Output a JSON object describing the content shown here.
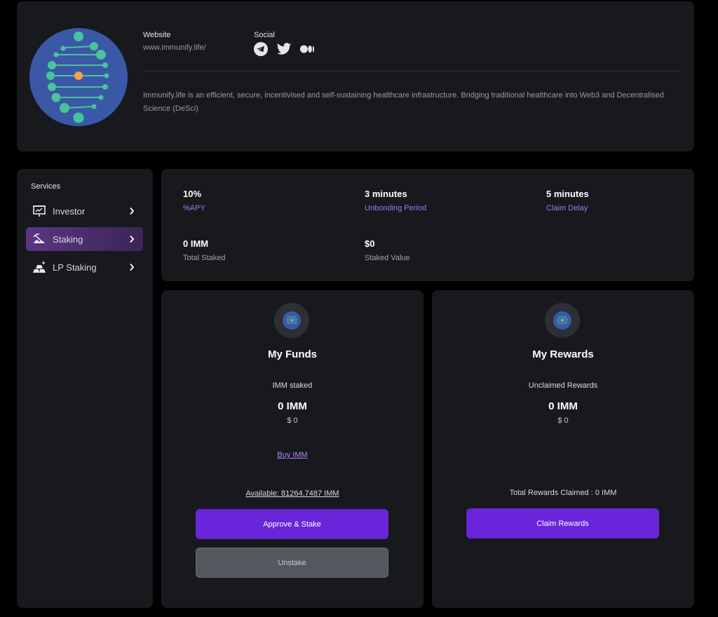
{
  "project": {
    "website_label": "Website",
    "website_url": "www.immunify.life/",
    "social_label": "Social",
    "social_icons": [
      "telegram-icon",
      "twitter-icon",
      "medium-icon"
    ],
    "description": "Immunify.life is an efficient, secure, incentivised and self-sustaining healthcare infrastructure. Bridging traditional healthcare into Web3 and Decentralised Science (DeSci)"
  },
  "sidebar": {
    "title": "Services",
    "items": [
      {
        "label": "Investor",
        "icon": "presentation-board-icon",
        "active": false
      },
      {
        "label": "Staking",
        "icon": "staking-pickaxe-icon",
        "active": true
      },
      {
        "label": "LP Staking",
        "icon": "gold-bars-icon",
        "active": false
      }
    ]
  },
  "stats": {
    "apy": {
      "value": "10%",
      "label": "%APY"
    },
    "unbonding": {
      "value": "3 minutes",
      "label": "Unbonding Period"
    },
    "claim_delay": {
      "value": "5 minutes",
      "label": "Claim Delay"
    },
    "total_staked": {
      "value": "0 IMM",
      "label": "Total Staked"
    },
    "staked_value": {
      "value": "$0",
      "label": "Staked Value"
    }
  },
  "funds": {
    "title": "My Funds",
    "subtitle": "IMM staked",
    "amount": "0 IMM",
    "usd": "$ 0",
    "buy_link": "Buy IMM",
    "available": "Available: 81264.7487 IMM",
    "approve_button": "Approve & Stake",
    "unstake_button": "Unstake"
  },
  "rewards": {
    "title": "My Rewards",
    "subtitle": "Unclaimed Rewards",
    "amount": "0 IMM",
    "usd": "$ 0",
    "total_claimed": "Total Rewards Claimed : 0 IMM",
    "claim_button": "Claim Rewards"
  },
  "colors": {
    "accent": "#6a24d9",
    "accent_text": "#a675f5",
    "card_bg": "#17191d",
    "logo_bg": "#3a58a6",
    "logo_dots": "#48c49a",
    "logo_center": "#f6a24b"
  }
}
